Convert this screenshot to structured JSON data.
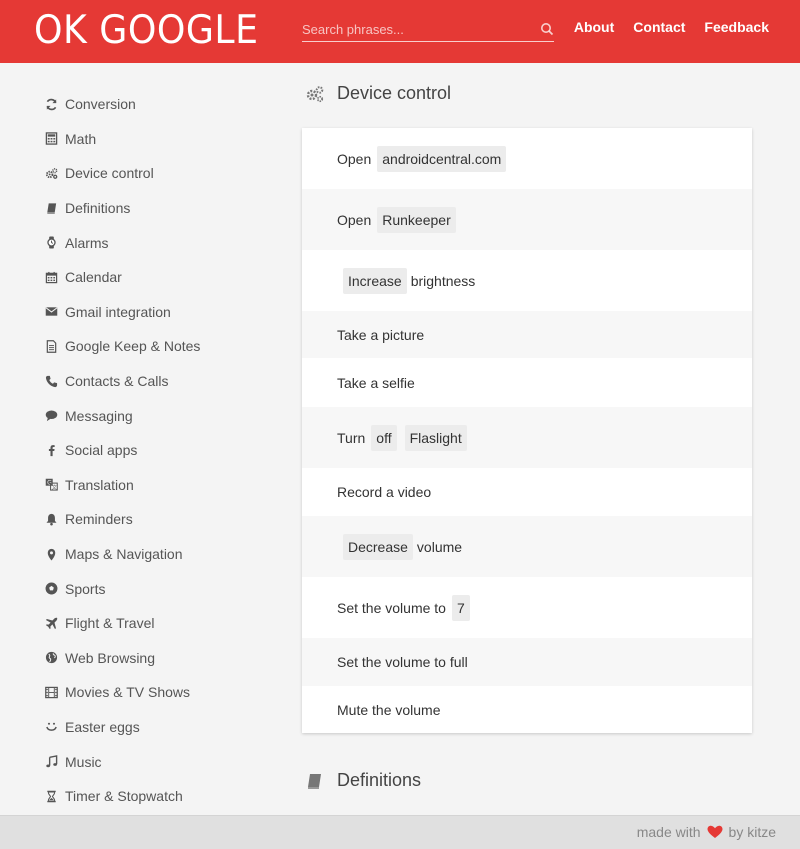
{
  "header": {
    "logo": "OK GOOGLE",
    "search_placeholder": "Search phrases...",
    "nav": [
      "About",
      "Contact",
      "Feedback"
    ]
  },
  "sidebar": {
    "items": [
      {
        "label": "Conversion",
        "icon": "refresh-icon"
      },
      {
        "label": "Math",
        "icon": "calculator-icon"
      },
      {
        "label": "Device control",
        "icon": "gears-icon"
      },
      {
        "label": "Definitions",
        "icon": "book-icon"
      },
      {
        "label": "Alarms",
        "icon": "watch-icon"
      },
      {
        "label": "Calendar",
        "icon": "calendar-icon"
      },
      {
        "label": "Gmail integration",
        "icon": "envelope-icon"
      },
      {
        "label": "Google Keep & Notes",
        "icon": "document-icon"
      },
      {
        "label": "Contacts & Calls",
        "icon": "phone-icon"
      },
      {
        "label": "Messaging",
        "icon": "speech-bubble-icon"
      },
      {
        "label": "Social apps",
        "icon": "facebook-icon"
      },
      {
        "label": "Translation",
        "icon": "translate-icon"
      },
      {
        "label": "Reminders",
        "icon": "bell-icon"
      },
      {
        "label": "Maps & Navigation",
        "icon": "map-pin-icon"
      },
      {
        "label": "Sports",
        "icon": "soccer-ball-icon"
      },
      {
        "label": "Flight & Travel",
        "icon": "airplane-icon"
      },
      {
        "label": "Web Browsing",
        "icon": "globe-icon"
      },
      {
        "label": "Movies & TV Shows",
        "icon": "film-icon"
      },
      {
        "label": "Easter eggs",
        "icon": "smiley-icon"
      },
      {
        "label": "Music",
        "icon": "music-note-icon"
      },
      {
        "label": "Timer & Stopwatch",
        "icon": "hourglass-icon"
      }
    ]
  },
  "main": {
    "section_title": "Device control",
    "next_section_title": "Definitions",
    "phrases": [
      {
        "parts": [
          {
            "t": "Open"
          },
          {
            "t": "androidcentral.com",
            "chip": true
          }
        ]
      },
      {
        "parts": [
          {
            "t": "Open"
          },
          {
            "t": "Runkeeper",
            "chip": true
          }
        ]
      },
      {
        "parts": [
          {
            "t": "Increase",
            "chip": true
          },
          {
            "t": "brightness"
          }
        ]
      },
      {
        "parts": [
          {
            "t": "Take a picture"
          }
        ]
      },
      {
        "parts": [
          {
            "t": "Take a selfie"
          }
        ]
      },
      {
        "parts": [
          {
            "t": "Turn"
          },
          {
            "t": "off",
            "chip": true
          },
          {
            "t": "Flaslight",
            "chip": true
          }
        ]
      },
      {
        "parts": [
          {
            "t": "Record a video"
          }
        ]
      },
      {
        "parts": [
          {
            "t": "Decrease",
            "chip": true
          },
          {
            "t": "volume"
          }
        ]
      },
      {
        "parts": [
          {
            "t": "Set the volume to"
          },
          {
            "t": "7",
            "chip": true
          }
        ]
      },
      {
        "parts": [
          {
            "t": "Set the volume to full"
          }
        ]
      },
      {
        "parts": [
          {
            "t": "Mute the volume"
          }
        ]
      }
    ]
  },
  "footer": {
    "made_with": "made with",
    "by": "by kitze"
  },
  "colors": {
    "brand": "#e53935",
    "heart": "#e53935"
  }
}
